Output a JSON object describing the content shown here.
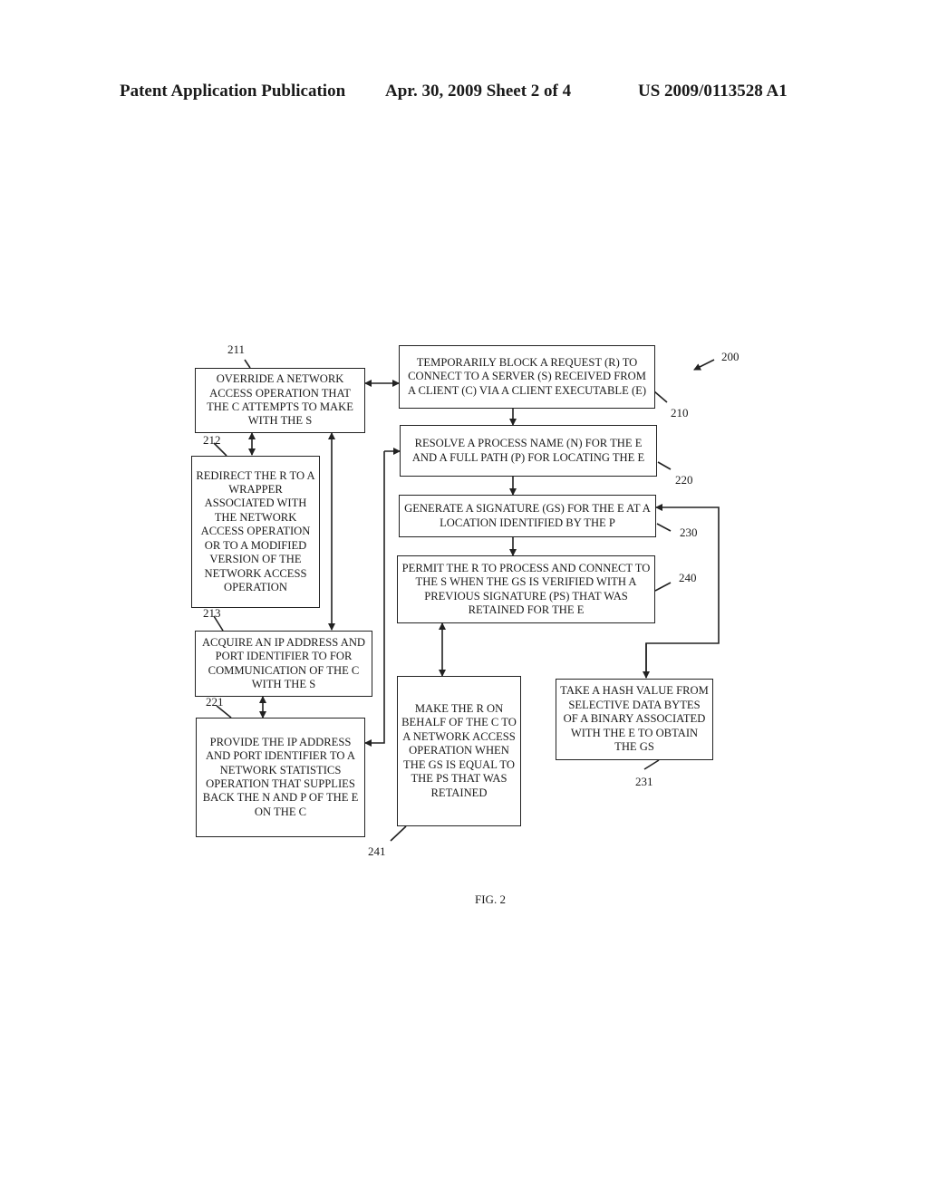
{
  "header": {
    "publication": "Patent Application Publication",
    "date_sheet": "Apr. 30, 2009  Sheet 2 of 4",
    "patent_number": "US 2009/0113528 A1"
  },
  "diagram": {
    "figure_ref": "200",
    "figure_label": "FIG. 2",
    "steps": {
      "s210": {
        "ref": "210",
        "text": "TEMPORARILY BLOCK A REQUEST (R) TO CONNECT TO A SERVER (S) RECEIVED FROM A CLIENT (C) VIA A CLIENT EXECUTABLE (E)"
      },
      "s211": {
        "ref": "211",
        "text": "OVERRIDE A NETWORK ACCESS OPERATION THAT THE C ATTEMPTS TO MAKE WITH THE S"
      },
      "s212": {
        "ref": "212",
        "text": "REDIRECT THE R TO A WRAPPER ASSOCIATED WITH THE NETWORK ACCESS OPERATION OR TO A MODIFIED VERSION OF THE NETWORK ACCESS OPERATION"
      },
      "s213": {
        "ref": "213",
        "text": "ACQUIRE AN IP ADDRESS AND PORT IDENTIFIER TO FOR COMMUNICATION OF THE C WITH THE S"
      },
      "s220": {
        "ref": "220",
        "text": "RESOLVE A PROCESS NAME (N) FOR THE E AND A FULL PATH (P) FOR LOCATING THE E"
      },
      "s221": {
        "ref": "221",
        "text": "PROVIDE THE IP ADDRESS AND PORT IDENTIFIER TO A NETWORK STATISTICS OPERATION THAT SUPPLIES BACK THE N AND P OF THE E ON THE C"
      },
      "s230": {
        "ref": "230",
        "text": "GENERATE A SIGNATURE (GS) FOR THE E AT A LOCATION IDENTIFIED BY THE P"
      },
      "s231": {
        "ref": "231",
        "text": "TAKE A HASH VALUE FROM SELECTIVE DATA BYTES OF A BINARY ASSOCIATED WITH THE E TO OBTAIN THE GS"
      },
      "s240": {
        "ref": "240",
        "text": "PERMIT THE R TO PROCESS AND CONNECT TO THE S WHEN THE GS IS VERIFIED WITH A PREVIOUS SIGNATURE (PS) THAT WAS RETAINED FOR THE E"
      },
      "s241": {
        "ref": "241",
        "text": "MAKE THE R ON BEHALF OF THE C TO A NETWORK ACCESS OPERATION WHEN THE GS IS EQUAL TO THE PS THAT WAS RETAINED"
      }
    }
  }
}
